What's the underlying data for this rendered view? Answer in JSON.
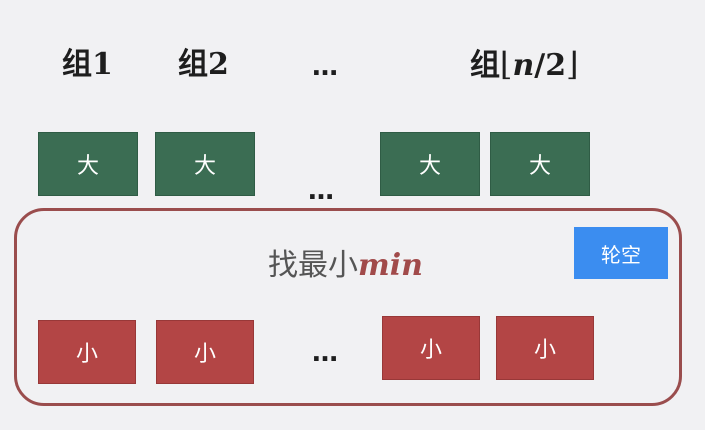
{
  "groups": [
    {
      "prefix": "组",
      "number": "1"
    },
    {
      "prefix": "组",
      "number": "2"
    },
    {
      "ellipsis": "…"
    },
    {
      "prefix": "组",
      "floor_left": "⌊",
      "n": "n",
      "slash": "/",
      "two": "2",
      "floor_right": "⌋"
    }
  ],
  "big_label": "大",
  "small_label": "小",
  "ellipsis": "…",
  "panel": {
    "title_prefix": "找最小",
    "title_italic": "min",
    "badge": "轮空"
  },
  "colors": {
    "big_box": "#3b6d53",
    "small_box": "#b34545",
    "panel_border": "#9a4d4d",
    "badge": "#3b8df0",
    "title_italic": "#a14a4a"
  }
}
